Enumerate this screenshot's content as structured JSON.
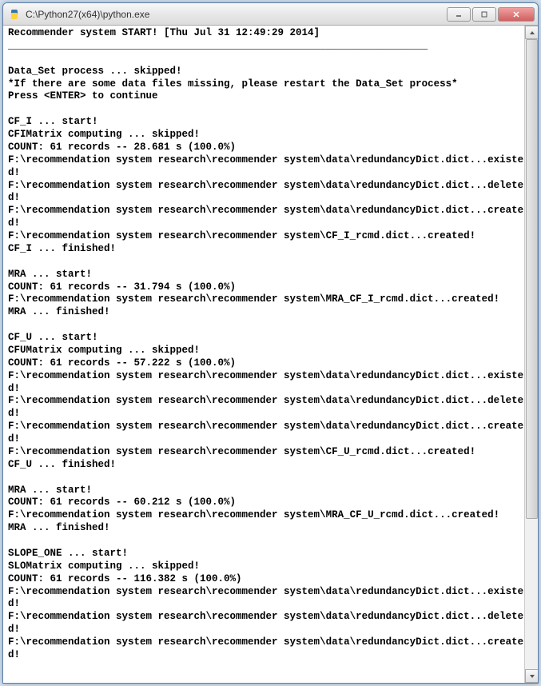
{
  "window": {
    "title": "C:\\Python27(x64)\\python.exe"
  },
  "terminal": {
    "lines": [
      "Recommender system START! [Thu Jul 31 12:49:29 2014]",
      "______________________________________________________________________",
      "",
      "Data_Set process ... skipped!",
      "*If there are some data files missing, please restart the Data_Set process*",
      "Press <ENTER> to continue",
      "",
      "CF_I ... start!",
      "CFIMatrix computing ... skipped!",
      "COUNT: 61 records -- 28.681 s (100.0%)",
      "F:\\recommendation system research\\recommender system\\data\\redundancyDict.dict...existed!",
      "F:\\recommendation system research\\recommender system\\data\\redundancyDict.dict...deleted!",
      "F:\\recommendation system research\\recommender system\\data\\redundancyDict.dict...created!",
      "F:\\recommendation system research\\recommender system\\CF_I_rcmd.dict...created!",
      "CF_I ... finished!",
      "",
      "MRA ... start!",
      "COUNT: 61 records -- 31.794 s (100.0%)",
      "F:\\recommendation system research\\recommender system\\MRA_CF_I_rcmd.dict...created!",
      "MRA ... finished!",
      "",
      "CF_U ... start!",
      "CFUMatrix computing ... skipped!",
      "COUNT: 61 records -- 57.222 s (100.0%)",
      "F:\\recommendation system research\\recommender system\\data\\redundancyDict.dict...existed!",
      "F:\\recommendation system research\\recommender system\\data\\redundancyDict.dict...deleted!",
      "F:\\recommendation system research\\recommender system\\data\\redundancyDict.dict...created!",
      "F:\\recommendation system research\\recommender system\\CF_U_rcmd.dict...created!",
      "CF_U ... finished!",
      "",
      "MRA ... start!",
      "COUNT: 61 records -- 60.212 s (100.0%)",
      "F:\\recommendation system research\\recommender system\\MRA_CF_U_rcmd.dict...created!",
      "MRA ... finished!",
      "",
      "SLOPE_ONE ... start!",
      "SLOMatrix computing ... skipped!",
      "COUNT: 61 records -- 116.382 s (100.0%)",
      "F:\\recommendation system research\\recommender system\\data\\redundancyDict.dict...existed!",
      "F:\\recommendation system research\\recommender system\\data\\redundancyDict.dict...deleted!",
      "F:\\recommendation system research\\recommender system\\data\\redundancyDict.dict...created!"
    ]
  }
}
